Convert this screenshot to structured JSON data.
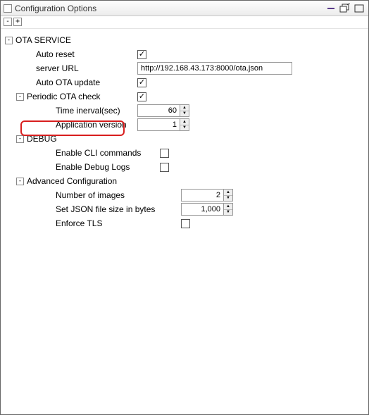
{
  "window": {
    "title": "Configuration Options"
  },
  "toolbar": {
    "collapse_all": "-",
    "expand_all": "+"
  },
  "tree": {
    "ota_service": {
      "label": "OTA SERVICE",
      "auto_reset": {
        "label": "Auto reset",
        "checked": true
      },
      "server_url": {
        "label": "server URL",
        "value": "http://192.168.43.173:8000/ota.json"
      },
      "auto_ota_update": {
        "label": "Auto OTA update",
        "checked": true
      },
      "periodic_ota_check": {
        "label": "Periodic OTA check",
        "checked": true,
        "time_interval": {
          "label": "Time inerval(sec)",
          "value": "60"
        },
        "application_version": {
          "label": "Application version",
          "value": "1"
        }
      },
      "debug": {
        "label": "DEBUG",
        "enable_cli": {
          "label": "Enable CLI commands",
          "checked": false
        },
        "enable_logs": {
          "label": "Enable Debug Logs",
          "checked": false
        }
      },
      "advanced": {
        "label": "Advanced Configuration",
        "num_images": {
          "label": "Number of images",
          "value": "2"
        },
        "json_size": {
          "label": "Set JSON file size in bytes",
          "value": "1,000"
        },
        "enforce_tls": {
          "label": "Enforce TLS",
          "checked": false
        }
      }
    }
  }
}
